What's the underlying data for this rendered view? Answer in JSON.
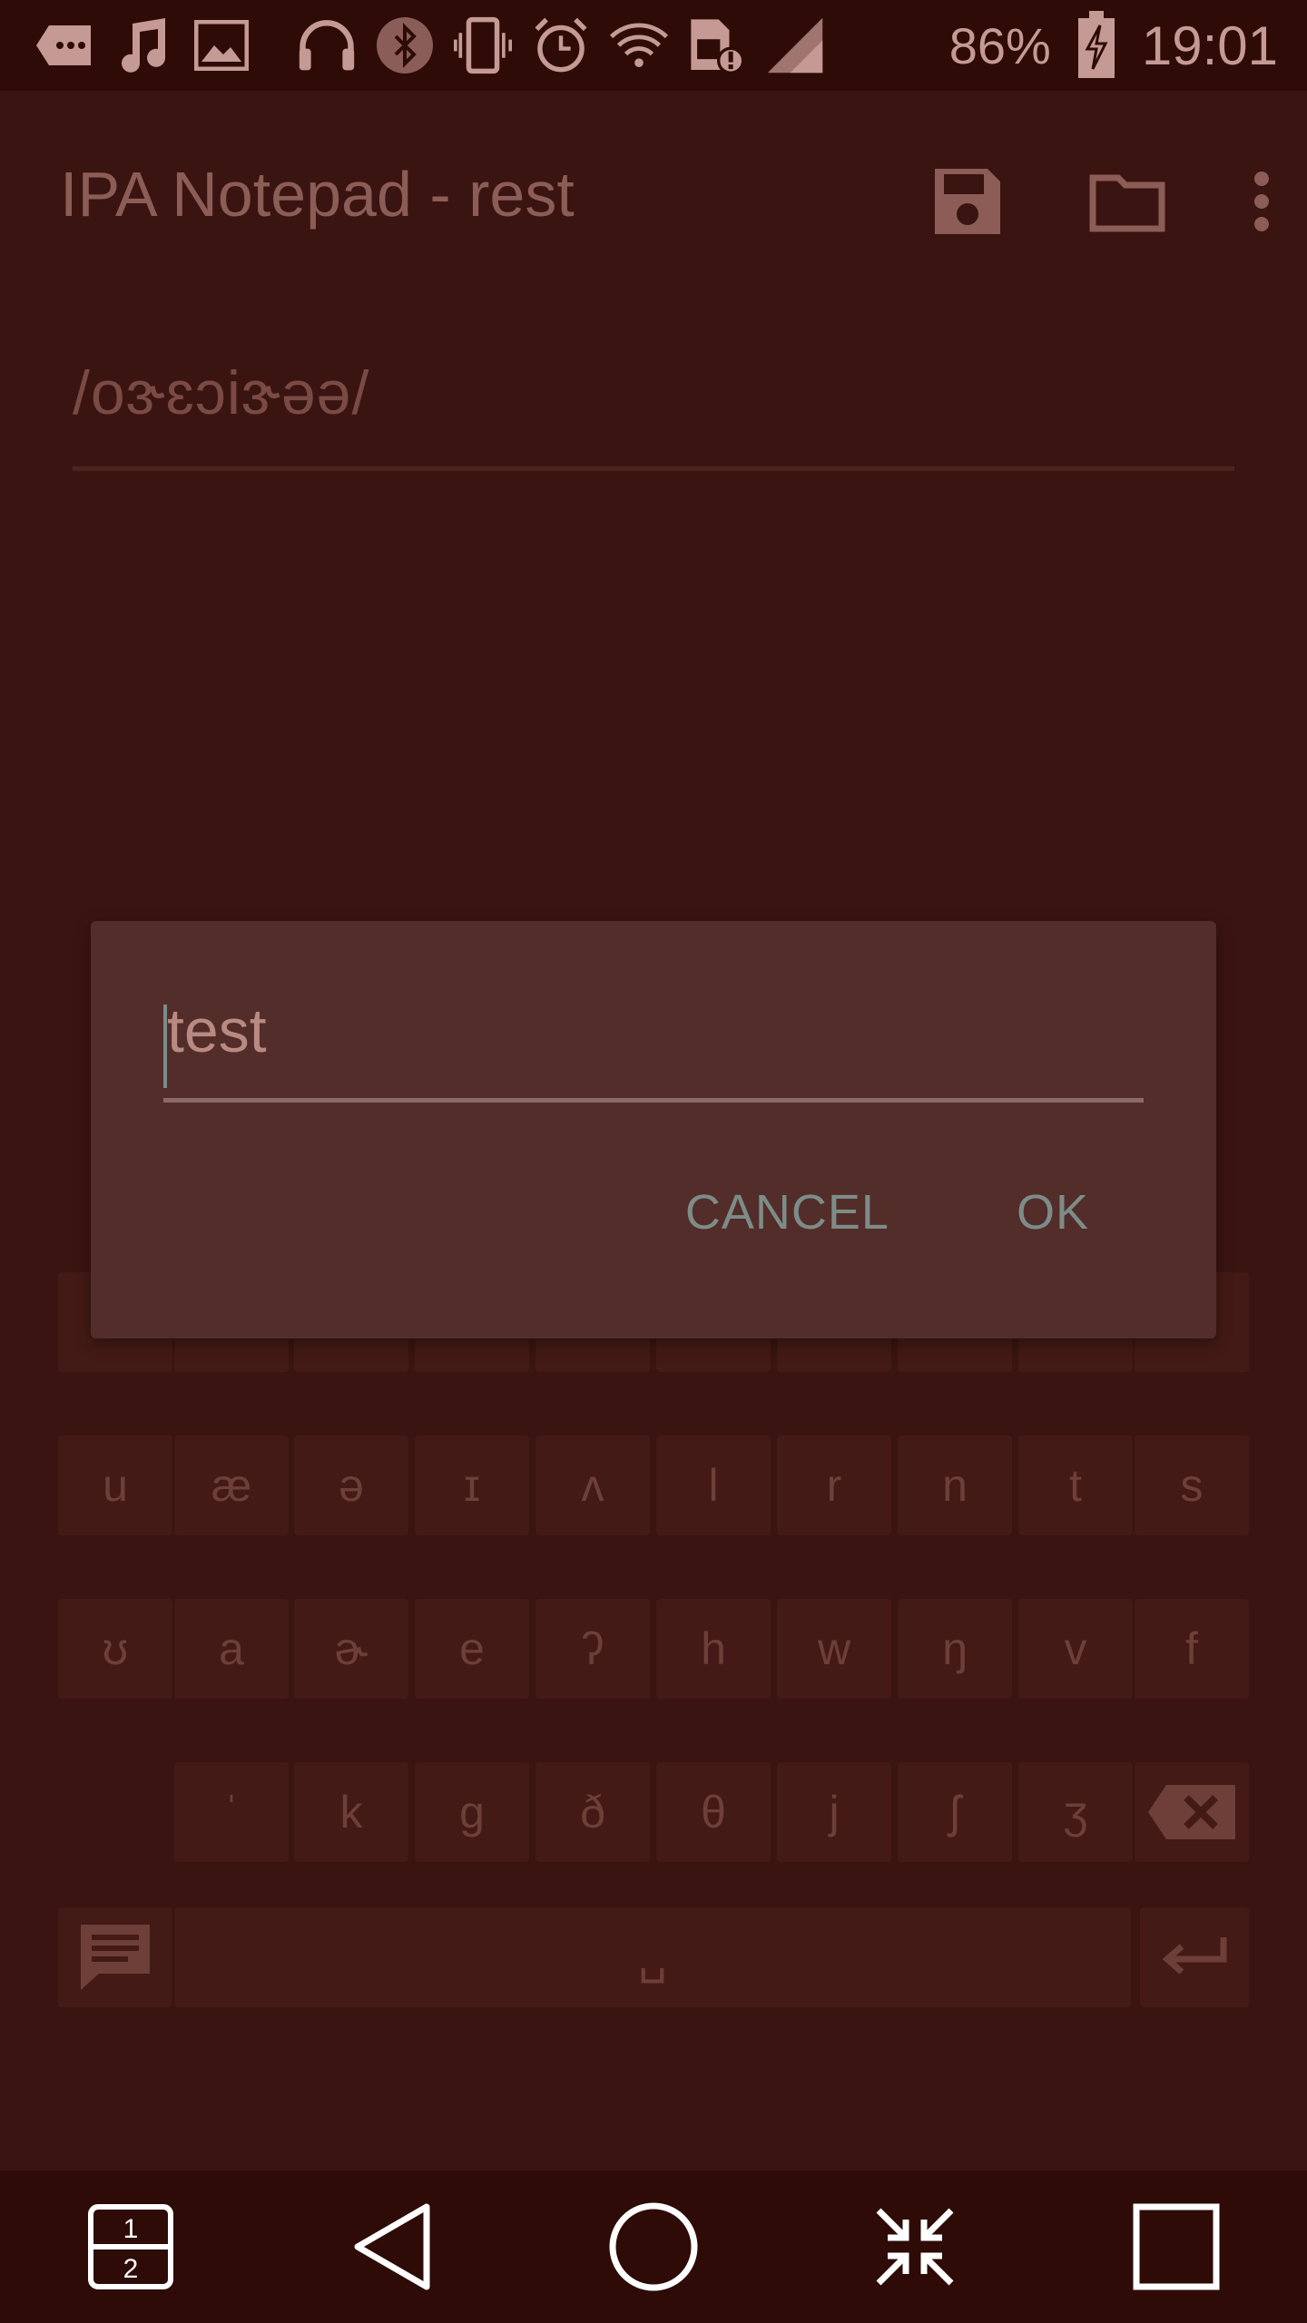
{
  "status_bar": {
    "icons_left": [
      "more-notification-icon",
      "music-note-icon",
      "image-icon",
      "headphones-icon",
      "bluetooth-icon",
      "vibrate-icon",
      "alarm-icon",
      "wifi-icon",
      "sim-alert-icon",
      "signal-icon"
    ],
    "battery_percent": "86%",
    "time": "19:01"
  },
  "app_bar": {
    "title": "IPA Notepad - rest",
    "actions": [
      "save-icon",
      "folder-icon",
      "overflow-menu-icon"
    ]
  },
  "editor": {
    "text": "/oɝɛɔiɝəə/"
  },
  "keyboard": {
    "row1": [
      "u",
      "æ",
      "ə",
      "ɪ",
      "ʌ",
      "l",
      "r",
      "n",
      "t",
      "s"
    ],
    "row2": [
      "ʊ",
      "a",
      "ɚ",
      "e",
      "ʔ",
      "h",
      "w",
      "ŋ",
      "v",
      "f"
    ],
    "row3": [
      "ˈ",
      "k",
      "g",
      "ð",
      "θ",
      "j",
      "ʃ",
      "ʒ"
    ],
    "space_label": "␣"
  },
  "dialog": {
    "input_value": "test",
    "cancel_label": "CANCEL",
    "ok_label": "OK"
  },
  "nav_bar": {
    "buttons": [
      "dual-window-icon",
      "back-icon",
      "home-icon",
      "collapse-icon",
      "recents-icon"
    ]
  },
  "colors": {
    "background": "#3a1410",
    "status_bar": "#2e0b07",
    "dialog": "#532d29",
    "button_text": "#7d8c88"
  }
}
